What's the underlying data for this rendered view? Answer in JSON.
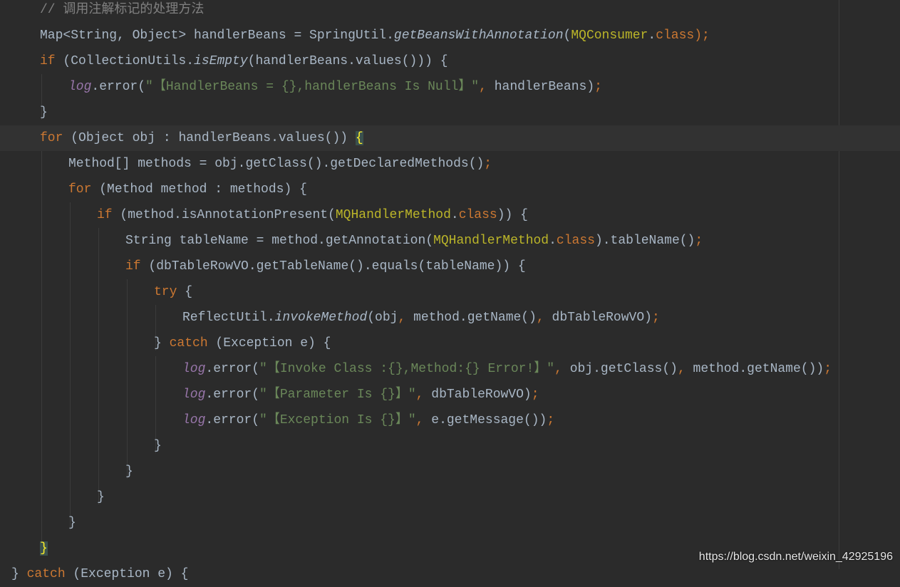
{
  "editor": {
    "lines": [
      {
        "indent": 2,
        "tokens": [
          {
            "t": "// 调用注解标记的处理方法",
            "c": "cm"
          }
        ]
      },
      {
        "indent": 2,
        "tokens": [
          {
            "t": "Map<String, Object> handlerBeans = SpringUtil.",
            "c": ""
          },
          {
            "t": "getBeansWithAnnotation",
            "c": "st"
          },
          {
            "t": "(",
            "c": ""
          },
          {
            "t": "MQConsumer",
            "c": "ann"
          },
          {
            "t": ".",
            "c": ""
          },
          {
            "t": "class",
            "c": "kw"
          },
          {
            "t": ");",
            "c": "semi"
          }
        ]
      },
      {
        "indent": 2,
        "tokens": [
          {
            "t": "if ",
            "c": "kw"
          },
          {
            "t": "(CollectionUtils.",
            "c": ""
          },
          {
            "t": "isEmpty",
            "c": "st"
          },
          {
            "t": "(handlerBeans.values())) {",
            "c": ""
          }
        ]
      },
      {
        "indent": 3,
        "tokens": [
          {
            "t": "log",
            "c": "fld"
          },
          {
            "t": ".error(",
            "c": ""
          },
          {
            "t": "\"【HandlerBeans = {},handlerBeans Is Null】\"",
            "c": "str"
          },
          {
            "t": ", ",
            "c": "kw"
          },
          {
            "t": "handlerBeans)",
            "c": ""
          },
          {
            "t": ";",
            "c": "semi"
          }
        ]
      },
      {
        "indent": 2,
        "tokens": [
          {
            "t": "}",
            "c": ""
          }
        ]
      },
      {
        "indent": 2,
        "current": true,
        "tokens": [
          {
            "t": "for ",
            "c": "kw"
          },
          {
            "t": "(Object obj : handlerBeans.values()) ",
            "c": ""
          },
          {
            "t": "{",
            "c": "brace-match"
          }
        ]
      },
      {
        "indent": 3,
        "tokens": [
          {
            "t": "Method[] methods = obj.getClass().getDeclaredMethods()",
            "c": ""
          },
          {
            "t": ";",
            "c": "semi"
          }
        ]
      },
      {
        "indent": 3,
        "tokens": [
          {
            "t": "for ",
            "c": "kw"
          },
          {
            "t": "(Method method : methods) {",
            "c": ""
          }
        ]
      },
      {
        "indent": 4,
        "tokens": [
          {
            "t": "if ",
            "c": "kw"
          },
          {
            "t": "(method.isAnnotationPresent(",
            "c": ""
          },
          {
            "t": "MQHandlerMethod",
            "c": "ann"
          },
          {
            "t": ".",
            "c": ""
          },
          {
            "t": "class",
            "c": "kw"
          },
          {
            "t": ")) {",
            "c": ""
          }
        ]
      },
      {
        "indent": 5,
        "tokens": [
          {
            "t": "String tableName = method.getAnnotation(",
            "c": ""
          },
          {
            "t": "MQHandlerMethod",
            "c": "ann"
          },
          {
            "t": ".",
            "c": ""
          },
          {
            "t": "class",
            "c": "kw"
          },
          {
            "t": ").tableName()",
            "c": ""
          },
          {
            "t": ";",
            "c": "semi"
          }
        ]
      },
      {
        "indent": 5,
        "tokens": [
          {
            "t": "if ",
            "c": "kw"
          },
          {
            "t": "(dbTableRowVO.getTableName().equals(tableName)) {",
            "c": ""
          }
        ]
      },
      {
        "indent": 6,
        "tokens": [
          {
            "t": "try ",
            "c": "kw"
          },
          {
            "t": "{",
            "c": ""
          }
        ]
      },
      {
        "indent": 7,
        "tokens": [
          {
            "t": "ReflectUtil.",
            "c": ""
          },
          {
            "t": "invokeMethod",
            "c": "st"
          },
          {
            "t": "(obj",
            "c": ""
          },
          {
            "t": ", ",
            "c": "kw"
          },
          {
            "t": "method.getName()",
            "c": ""
          },
          {
            "t": ", ",
            "c": "kw"
          },
          {
            "t": "dbTableRowVO)",
            "c": ""
          },
          {
            "t": ";",
            "c": "semi"
          }
        ]
      },
      {
        "indent": 6,
        "tokens": [
          {
            "t": "} ",
            "c": ""
          },
          {
            "t": "catch ",
            "c": "kw"
          },
          {
            "t": "(Exception e) {",
            "c": ""
          }
        ]
      },
      {
        "indent": 7,
        "tokens": [
          {
            "t": "log",
            "c": "fld"
          },
          {
            "t": ".error(",
            "c": ""
          },
          {
            "t": "\"【Invoke Class :{},Method:{} Error!】\"",
            "c": "str"
          },
          {
            "t": ", ",
            "c": "kw"
          },
          {
            "t": "obj.getClass()",
            "c": ""
          },
          {
            "t": ", ",
            "c": "kw"
          },
          {
            "t": "method.getName())",
            "c": ""
          },
          {
            "t": ";",
            "c": "semi"
          }
        ]
      },
      {
        "indent": 7,
        "tokens": [
          {
            "t": "log",
            "c": "fld"
          },
          {
            "t": ".error(",
            "c": ""
          },
          {
            "t": "\"【Parameter Is {}】\"",
            "c": "str"
          },
          {
            "t": ", ",
            "c": "kw"
          },
          {
            "t": "dbTableRowVO)",
            "c": ""
          },
          {
            "t": ";",
            "c": "semi"
          }
        ]
      },
      {
        "indent": 7,
        "tokens": [
          {
            "t": "log",
            "c": "fld"
          },
          {
            "t": ".error(",
            "c": ""
          },
          {
            "t": "\"【Exception Is {}】\"",
            "c": "str"
          },
          {
            "t": ", ",
            "c": "kw"
          },
          {
            "t": "e.getMessage())",
            "c": ""
          },
          {
            "t": ";",
            "c": "semi"
          }
        ]
      },
      {
        "indent": 6,
        "tokens": [
          {
            "t": "}",
            "c": ""
          }
        ]
      },
      {
        "indent": 5,
        "tokens": [
          {
            "t": "}",
            "c": ""
          }
        ]
      },
      {
        "indent": 4,
        "tokens": [
          {
            "t": "}",
            "c": ""
          }
        ]
      },
      {
        "indent": 3,
        "tokens": [
          {
            "t": "}",
            "c": ""
          }
        ]
      },
      {
        "indent": 2,
        "tokens": [
          {
            "t": "}",
            "c": "brace-match2"
          }
        ]
      },
      {
        "indent": 1,
        "tokens": [
          {
            "t": "} ",
            "c": ""
          },
          {
            "t": "catch ",
            "c": "kw"
          },
          {
            "t": "(Exception e) {",
            "c": ""
          }
        ]
      }
    ]
  },
  "watermark": "https://blog.csdn.net/weixin_42925196",
  "colors": {
    "background": "#2b2b2b",
    "keyword": "#cc7832",
    "string": "#6a8759",
    "annotation": "#bbb529",
    "field": "#9876aa",
    "comment": "#808080"
  }
}
